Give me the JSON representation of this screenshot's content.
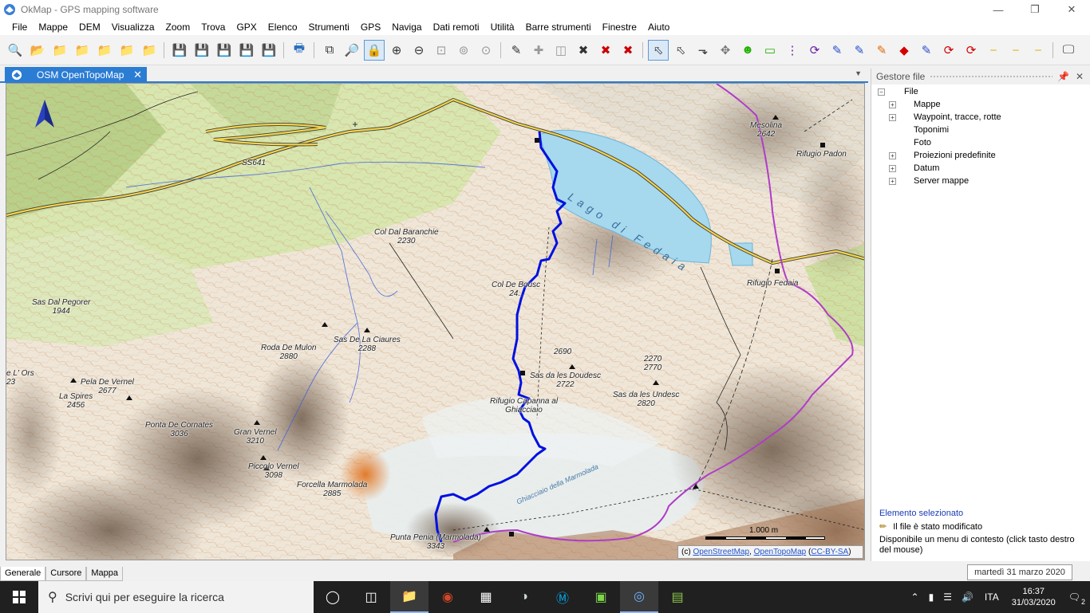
{
  "window": {
    "title": "OkMap - GPS mapping software",
    "app_icon": "okmap-icon"
  },
  "menu": [
    "File",
    "Mappe",
    "DEM",
    "Visualizza",
    "Zoom",
    "Trova",
    "GPX",
    "Elenco",
    "Strumenti",
    "GPS",
    "Naviga",
    "Dati remoti",
    "Utilità",
    "Barre strumenti",
    "Finestre",
    "Aiuto"
  ],
  "map_tab": {
    "label": "OSM OpenTopoMap"
  },
  "map": {
    "labels": [
      {
        "text": "SS641"
      },
      {
        "text": "Col Dal Baranchie\n2230"
      },
      {
        "text": "Sas Dal Pegorer\n1944"
      },
      {
        "text": "Roda De Mulon\n2880"
      },
      {
        "text": "Sas De La Ciaures\n2288"
      },
      {
        "text": "Col De Bousc\n24.."
      },
      {
        "text": "2690"
      },
      {
        "text": "2270\n2770"
      },
      {
        "text": "Sas da les Doudesc\n2722"
      },
      {
        "text": "Sas da les Undesc\n2820"
      },
      {
        "text": "Rifugio Capanna al\nGhiacciaio"
      },
      {
        "text": "Pela De Vernel\n2677"
      },
      {
        "text": "La Spires\n2456"
      },
      {
        "text": "Ponta De Cornates\n3036"
      },
      {
        "text": "Gran Vernel\n3210"
      },
      {
        "text": "Piccolo Vernel\n3098"
      },
      {
        "text": "Forcella Marmolada\n2885"
      },
      {
        "text": "Punta Penia (Marmolada)\n3343"
      },
      {
        "text": "Mesolina\n2642"
      },
      {
        "text": "Rifugio Padon"
      },
      {
        "text": "Rifugio Fedaia"
      },
      {
        "text": "Lago di Fedaia"
      },
      {
        "text": "Ghiacciaio della Marmolada"
      },
      {
        "text": "e L' Ors\n23"
      }
    ],
    "scale_label": "1.000 m",
    "attribution": {
      "prefix": "(c)",
      "osm": "OpenStreetMap",
      "otm": "OpenTopoMap",
      "license": "CC-BY-SA"
    }
  },
  "panel": {
    "title": "Gestore file",
    "tree": {
      "root": "File",
      "children": [
        {
          "label": "Mappe",
          "expandable": true
        },
        {
          "label": "Waypoint, tracce, rotte",
          "expandable": true
        },
        {
          "label": "Toponimi",
          "expandable": false
        },
        {
          "label": "Foto",
          "expandable": false
        },
        {
          "label": "Proiezioni predefinite",
          "expandable": true
        },
        {
          "label": "Datum",
          "expandable": true
        },
        {
          "label": "Server mappe",
          "expandable": true
        }
      ]
    },
    "selected_title": "Elemento selezionato",
    "selected_status": "Il file è stato modificato",
    "context_hint": "Disponibile un menu di contesto (click tasto destro del mouse)"
  },
  "bottom_tabs": [
    "Generale",
    "Cursore",
    "Mappa"
  ],
  "tooltip": "martedì 31 marzo 2020",
  "taskbar": {
    "search_placeholder": "Scrivi qui per eseguire la ricerca",
    "language": "ITA",
    "time": "16:37",
    "date": "31/03/2020",
    "notifications": "2"
  },
  "colors": {
    "accent": "#2b7cd3",
    "track": "#0010e0",
    "lake": "#a6d8ee",
    "route": "#b03cc8"
  }
}
